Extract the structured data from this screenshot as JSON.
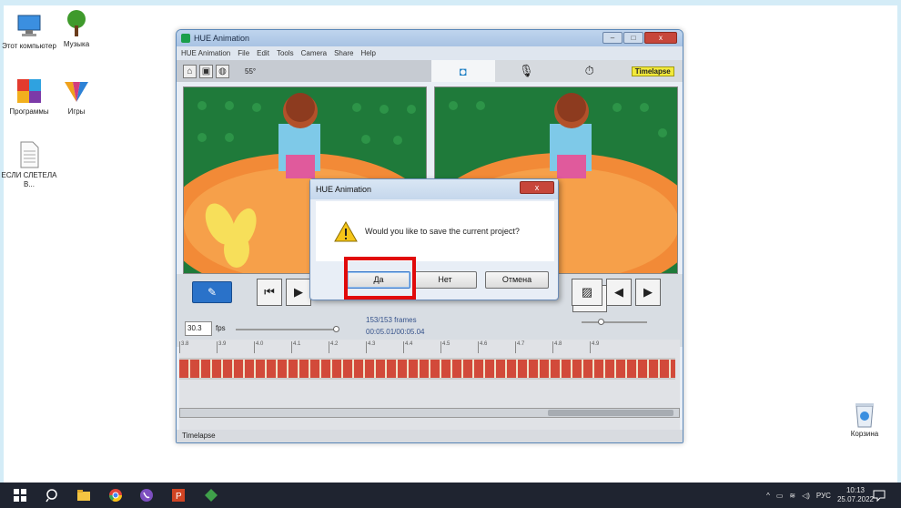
{
  "desktop": {
    "icons": [
      {
        "label": "Этот компьютер"
      },
      {
        "label": "Музыка"
      },
      {
        "label": "Программы"
      },
      {
        "label": "Игры"
      },
      {
        "label": "ЕСЛИ СЛЕТЕЛА В..."
      }
    ],
    "recycle_bin": {
      "label": "Корзина"
    }
  },
  "app": {
    "title": "HUE Animation",
    "menu": [
      "HUE Animation",
      "File",
      "Edit",
      "Tools",
      "Camera",
      "Share",
      "Help"
    ],
    "zoom": "55°",
    "mode_tabs": [
      {
        "icon": "camera-icon",
        "active": true
      },
      {
        "icon": "microphone-icon",
        "active": false
      },
      {
        "icon": "stopwatch-icon",
        "active": false
      },
      {
        "label": "Timelapse",
        "active": false
      }
    ],
    "fps_value": "30.3",
    "fps_label": "fps",
    "frames_count": "153/153 frames",
    "frames_time": "00:05.01/00:05.04",
    "timeline_ticks": [
      "3.8",
      "3.9",
      "4.0",
      "4.1",
      "4.2",
      "4.3",
      "4.4",
      "4.5",
      "4.6",
      "4.7",
      "4.8",
      "4.9"
    ],
    "statusbar": "Timelapse"
  },
  "dialog": {
    "title": "HUE Animation",
    "message": "Would you like to save the current project?",
    "buttons": {
      "yes": "Да",
      "no": "Нет",
      "cancel": "Отмена"
    },
    "close_label": "x"
  },
  "taskbar": {
    "language": "РУС",
    "time": "10:13",
    "date": "25.07.2022"
  },
  "colors": {
    "highlight": "#e10a0a",
    "taskbar": "#1f2430",
    "titlebar": "#a8c3e3",
    "accent": "#2a72c9"
  }
}
